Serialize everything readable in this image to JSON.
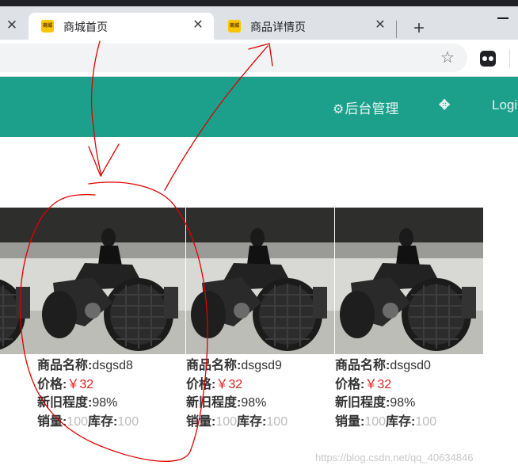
{
  "browser": {
    "tabs": [
      {
        "title": "商城首页",
        "favicon": "商城",
        "active": true
      },
      {
        "title": "商品详情页",
        "favicon": "商城",
        "active": false
      }
    ],
    "close_glyph": "✕",
    "new_tab_glyph": "+",
    "star_glyph": "☆"
  },
  "site_nav": {
    "admin_label": "后台管理",
    "gear_glyph": "⚙",
    "fullscreen_glyph": "✥",
    "login_label": "Logi"
  },
  "labels": {
    "name": "商品名称:",
    "price": "价格:",
    "condition": "新旧程度:",
    "sales": "销量:",
    "stock": "库存:"
  },
  "products": [
    {
      "name": "dsgsd8",
      "price": "￥32",
      "condition": "98%",
      "sales": "100",
      "stock": "100"
    },
    {
      "name": "dsgsd9",
      "price": "￥32",
      "condition": "98%",
      "sales": "100",
      "stock": "100"
    },
    {
      "name": "dsgsd0",
      "price": "￥32",
      "condition": "98%",
      "sales": "100",
      "stock": "100"
    }
  ],
  "watermark": "https://blog.csdn.net/qq_40634846",
  "colors": {
    "header_teal": "#1ca08c",
    "price_red": "#e02020",
    "annotation_red": "#e00000"
  }
}
